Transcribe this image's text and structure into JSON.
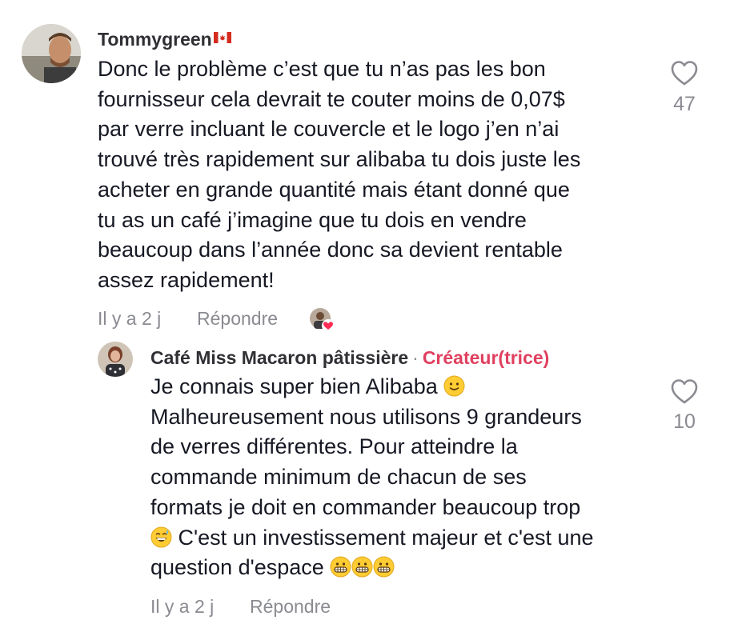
{
  "comments": [
    {
      "username": "Tommygreen",
      "text_lines": [
        "Donc le problème c’est que tu n’as pas les bon",
        "fournisseur cela devrait te couter moins de 0,07$",
        "par verre incluant le couvercle et le logo j’en n’ai",
        "trouvé très rapidement sur alibaba tu dois juste les",
        "acheter en grande quantité mais étant donné que",
        "tu as un café j’imagine que tu dois en vendre",
        "beaucoup dans l’année donc sa devient rentable",
        "assez rapidement!"
      ],
      "time": "Il y a 2 j",
      "reply_label": "Répondre",
      "likes": "47"
    },
    {
      "username": "Café Miss Macaron pâtissière",
      "separator": "·",
      "badge": "Créateur(trice)",
      "text_lines": [
        "Je connais super bien Alibaba",
        "Malheureusement nous utilisons 9 grandeurs",
        "de verres différentes. Pour atteindre la",
        "commande minimum de chacun de ses",
        "formats je doit en commander beaucoup trop",
        "C'est un investissement majeur et c'est une",
        "question d'espace"
      ],
      "time": "Il y a 2 j",
      "reply_label": "Répondre",
      "likes": "10"
    }
  ],
  "icons": {
    "like": "heart-outline-icon",
    "flag": "canada-flag-icon",
    "creator_liked": "creator-liked-heart-icon",
    "emoji_smile": "slightly-smiling-face-emoji",
    "emoji_sweat": "grinning-sweat-emoji",
    "emoji_grimace": "grimacing-face-emoji"
  },
  "colors": {
    "text": "#161823",
    "muted": "#8a8b91",
    "creator": "#e0405f"
  }
}
